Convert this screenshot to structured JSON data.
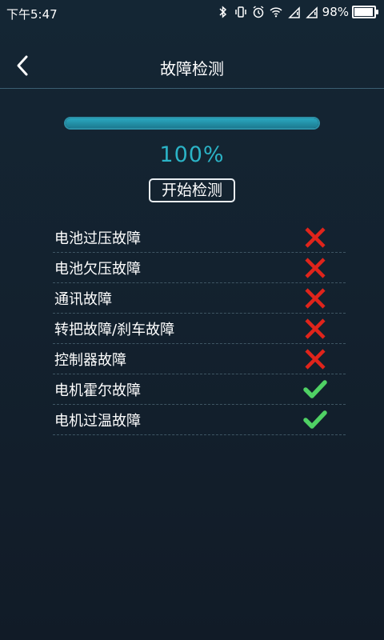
{
  "status_bar": {
    "time": "下午5:47",
    "battery_percent_text": "98%",
    "battery_level": 0.98,
    "icons": [
      "bluetooth-icon",
      "vibrate-icon",
      "alarm-icon",
      "wifi-icon",
      "signal-icon",
      "signal-icon",
      "battery-icon"
    ]
  },
  "nav": {
    "title": "故障检测",
    "back_icon": "chevron-left-icon"
  },
  "progress": {
    "value": 1.0,
    "text": "100%"
  },
  "start_button": {
    "label": "开始检测"
  },
  "faults": [
    {
      "label": "电池过压故障",
      "status": "fault"
    },
    {
      "label": "电池欠压故障",
      "status": "fault"
    },
    {
      "label": "通讯故障",
      "status": "fault"
    },
    {
      "label": "转把故障/刹车故障",
      "status": "fault"
    },
    {
      "label": "控制器故障",
      "status": "fault"
    },
    {
      "label": "电机霍尔故障",
      "status": "ok"
    },
    {
      "label": "电机过温故障",
      "status": "ok"
    }
  ],
  "colors": {
    "accent": "#2bb3c6",
    "fault": "#e0241b",
    "ok": "#4fd164",
    "background": "#13212e"
  }
}
